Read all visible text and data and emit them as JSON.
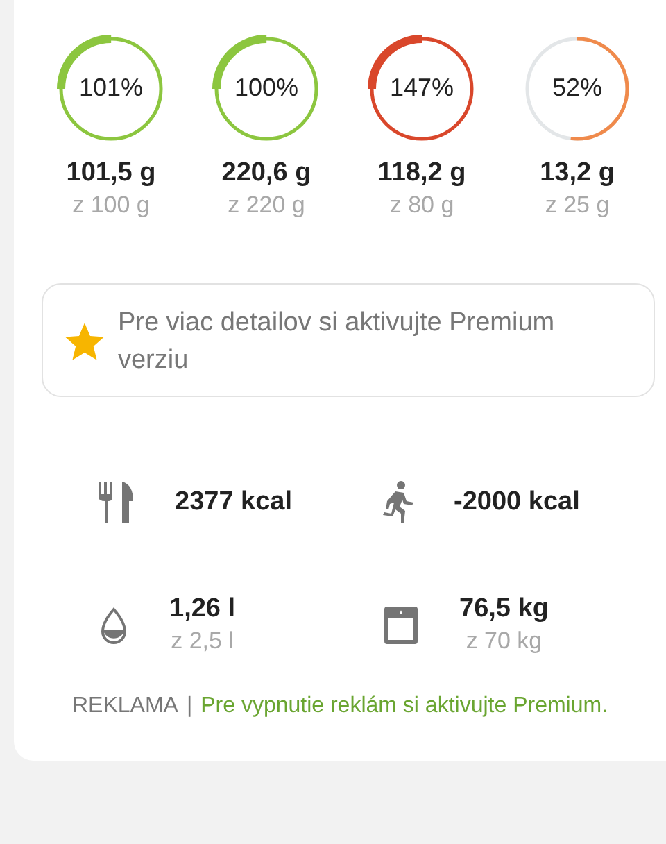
{
  "rings": [
    {
      "percent": "101%",
      "amount": "101,5 g",
      "goal": "z 100 g",
      "color": "#8cc63f"
    },
    {
      "percent": "100%",
      "amount": "220,6 g",
      "goal": "z 220 g",
      "color": "#8cc63f"
    },
    {
      "percent": "147%",
      "amount": "118,2 g",
      "goal": "z 80 g",
      "color": "#d9472b"
    },
    {
      "percent": "52%",
      "amount": "13,2 g",
      "goal": "z 25 g",
      "color": "#f08a4b"
    }
  ],
  "premium_banner": {
    "text": "Pre viac detailov si aktivujte Premium verziu"
  },
  "stats": [
    {
      "kind": "food",
      "value": "2377 kcal"
    },
    {
      "kind": "exercise",
      "value": "-2000 kcal"
    },
    {
      "kind": "water",
      "value": "1,26 l",
      "goal": "z 2,5 l"
    },
    {
      "kind": "weight",
      "value": "76,5 kg",
      "goal": "z 70 kg"
    }
  ],
  "ad_notice": {
    "label": "REKLAMA",
    "separator": "|",
    "link": "Pre vypnutie reklám si aktivujte Premium."
  }
}
